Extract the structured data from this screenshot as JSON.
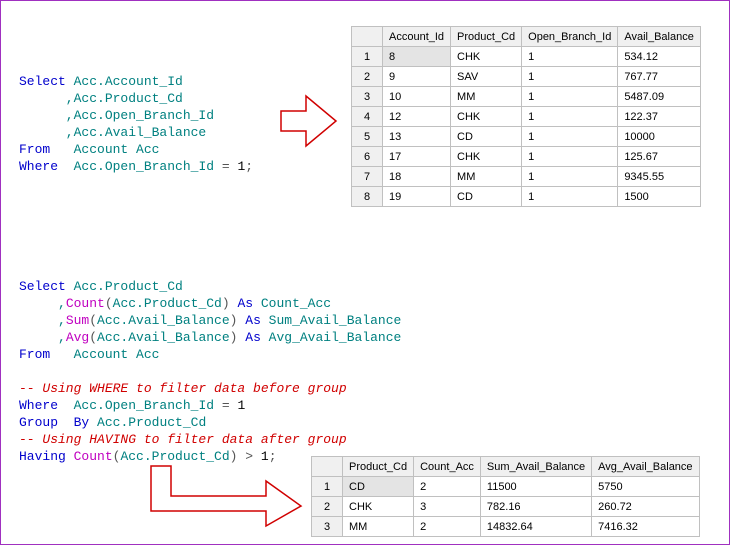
{
  "code1": {
    "l1a": "Select",
    "l1b": " Acc.Account_Id",
    "l2": "      ,Acc.Product_Cd",
    "l3": "      ,Acc.Open_Branch_Id",
    "l4": "      ,Acc.Avail_Balance",
    "l5a": "From",
    "l5b": "   Account Acc",
    "l6a": "Where",
    "l6b": "  Acc.Open_Branch_Id ",
    "l6c": "=",
    "l6d": " 1",
    "l6e": ";"
  },
  "table1": {
    "headers": [
      "",
      "Account_Id",
      "Product_Cd",
      "Open_Branch_Id",
      "Avail_Balance"
    ],
    "rows": [
      [
        "1",
        "8",
        "CHK",
        "1",
        "534.12"
      ],
      [
        "2",
        "9",
        "SAV",
        "1",
        "767.77"
      ],
      [
        "3",
        "10",
        "MM",
        "1",
        "5487.09"
      ],
      [
        "4",
        "12",
        "CHK",
        "1",
        "122.37"
      ],
      [
        "5",
        "13",
        "CD",
        "1",
        "10000"
      ],
      [
        "6",
        "17",
        "CHK",
        "1",
        "125.67"
      ],
      [
        "7",
        "18",
        "MM",
        "1",
        "9345.55"
      ],
      [
        "8",
        "19",
        "CD",
        "1",
        "1500"
      ]
    ]
  },
  "code2": {
    "l1a": "Select",
    "l1b": " Acc.Product_Cd",
    "l2a": "     ,",
    "l2b": "Count",
    "l2c": "(",
    "l2d": "Acc.Product_Cd",
    "l2e": ")",
    "l2f": " As",
    "l2g": " Count_Acc",
    "l3a": "     ,",
    "l3b": "Sum",
    "l3c": "(",
    "l3d": "Acc.Avail_Balance",
    "l3e": ")",
    "l3f": " As",
    "l3g": " Sum_Avail_Balance",
    "l4a": "     ,",
    "l4b": "Avg",
    "l4c": "(",
    "l4d": "Acc.Avail_Balance",
    "l4e": ")",
    "l4f": " As",
    "l4g": " Avg_Avail_Balance",
    "l5a": "From",
    "l5b": "   Account Acc",
    "l6": "",
    "l7": "-- Using WHERE to filter data before group",
    "l8a": "Where",
    "l8b": "  Acc.Open_Branch_Id ",
    "l8c": "=",
    "l8d": " 1",
    "l9a": "Group",
    "l9b": "  By",
    "l9c": " Acc.Product_Cd",
    "l10": "-- Using HAVING to filter data after group",
    "l11a": "Having",
    "l11b": " Count",
    "l11c": "(",
    "l11d": "Acc.Product_Cd",
    "l11e": ")",
    "l11f": " >",
    "l11g": " 1",
    "l11h": ";"
  },
  "table2": {
    "headers": [
      "",
      "Product_Cd",
      "Count_Acc",
      "Sum_Avail_Balance",
      "Avg_Avail_Balance"
    ],
    "rows": [
      [
        "1",
        "CD",
        "2",
        "11500",
        "5750"
      ],
      [
        "2",
        "CHK",
        "3",
        "782.16",
        "260.72"
      ],
      [
        "3",
        "MM",
        "2",
        "14832.64",
        "7416.32"
      ]
    ]
  }
}
